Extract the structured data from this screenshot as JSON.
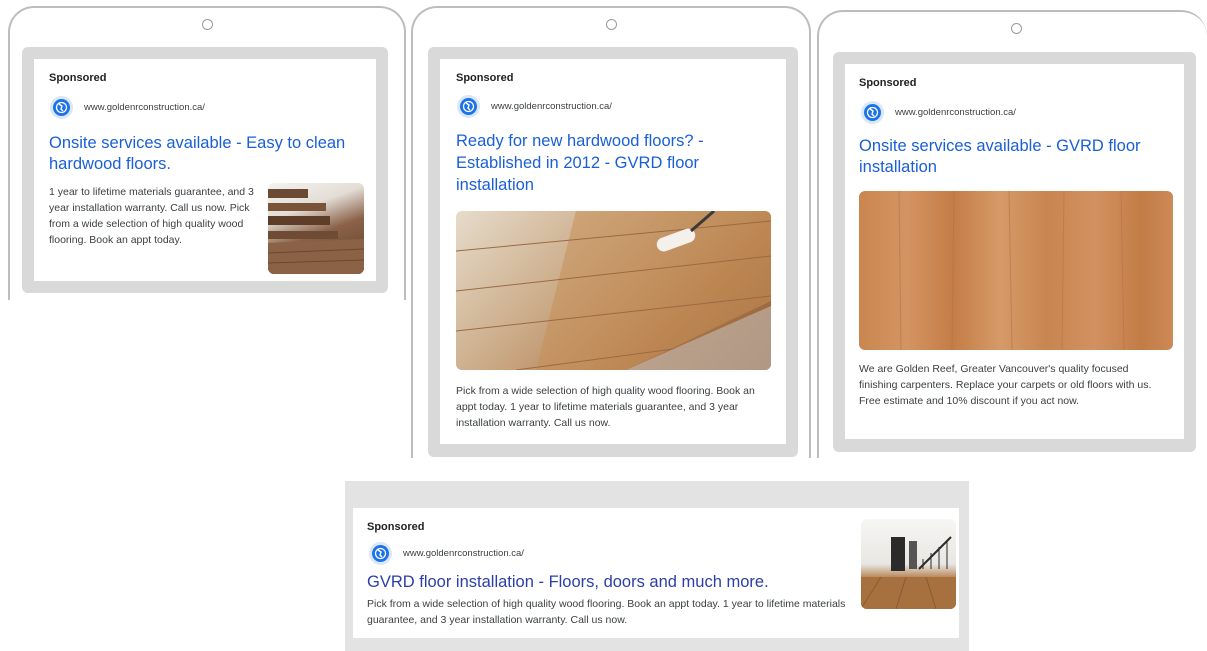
{
  "ads": [
    {
      "sponsored": "Sponsored",
      "url": "www.goldenrconstruction.ca/",
      "headline": "Onsite services available - Easy to clean hardwood floors.",
      "description": "1 year to lifetime materials guarantee, and 3 year installation warranty. Call us now. Pick from a wide selection of high quality wood flooring. Book an appt today.",
      "image": "hardwood-planks-stack-image"
    },
    {
      "sponsored": "Sponsored",
      "url": "www.goldenrconstruction.ca/",
      "headline": "Ready for new hardwood floors? - Established in 2012 - GVRD floor installation",
      "description": "Pick from a wide selection of high quality wood flooring. Book an appt today. 1 year to lifetime materials guarantee, and 3 year installation warranty. Call us now.",
      "image": "floor-varnish-roller-image"
    },
    {
      "sponsored": "Sponsored",
      "url": "www.goldenrconstruction.ca/",
      "headline": "Onsite services available - GVRD floor installation",
      "description": "We are Golden Reef, Greater Vancouver's quality focused finishing carpenters. Replace your carpets or old floors with us. Free estimate and 10% discount if you act now.",
      "image": "wood-grain-panel-image"
    },
    {
      "sponsored": "Sponsored",
      "url": "www.goldenrconstruction.ca/",
      "headline": "GVRD floor installation - Floors, doors and much more.",
      "description": "Pick from a wide selection of high quality wood flooring. Book an appt today. 1 year to lifetime materials guarantee, and 3 year installation warranty. Call us now.",
      "image": "interior-hallway-stairs-image"
    }
  ],
  "colors": {
    "headline": "#1a5fd6",
    "globe": "#1a73e8",
    "frame": "#d9d9d9"
  }
}
